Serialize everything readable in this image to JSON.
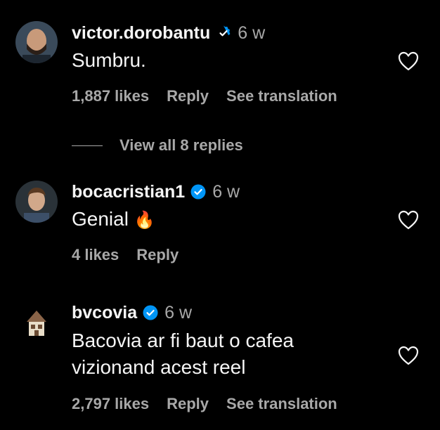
{
  "colors": {
    "background": "#000000",
    "primary_text": "#f5f5f5",
    "secondary_text": "#a8a8a8",
    "verified_badge": "#0095f6"
  },
  "comments": [
    {
      "username": "victor.dorobantu",
      "verified": true,
      "timestamp": "6 w",
      "text": "Sumbru.",
      "likes": "1,887 likes",
      "reply_label": "Reply",
      "translation_label": "See translation",
      "avatar_icon": "avatar-bald-man-beard"
    },
    {
      "username": "bocacristian1",
      "verified": true,
      "timestamp": "6 w",
      "text": "Genial",
      "emoji": "🔥",
      "likes": "4 likes",
      "reply_label": "Reply",
      "avatar_icon": "avatar-man-brown-hair"
    },
    {
      "username": "bvcovia",
      "verified": true,
      "timestamp": "6 w",
      "text_lines": [
        "Bacovia ar fi baut o cafea",
        "vizionand acest reel"
      ],
      "likes": "2,797 likes",
      "reply_label": "Reply",
      "translation_label": "See translation",
      "avatar_icon": "avatar-house-logo"
    }
  ],
  "view_replies": {
    "label": "View all 8 replies"
  }
}
